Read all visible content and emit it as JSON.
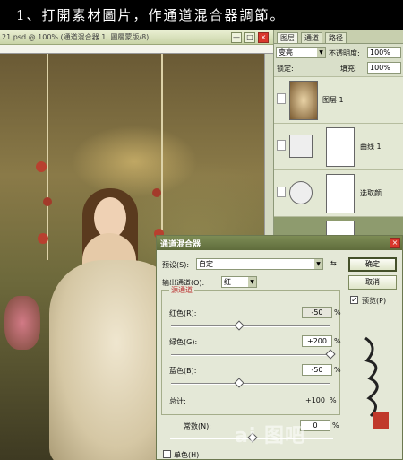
{
  "banner": {
    "text": "1、打開素材圖片，作通道混合器調節。"
  },
  "document": {
    "title": "21.psd @ 100% (通道混合器 1, 圖層蒙版/8)",
    "minimize": "—",
    "maximize": "□",
    "close": "×"
  },
  "layers_panel": {
    "tabs": [
      "图层",
      "通道",
      "路径"
    ],
    "blend_mode": "变亮",
    "opacity_label": "不透明度:",
    "opacity_value": "100%",
    "lock_label": "锁定:",
    "fill_label": "填充:",
    "fill_value": "100%",
    "layers": [
      {
        "name": "图层 1"
      },
      {
        "name": "曲线 1"
      },
      {
        "name": "选取颜..."
      },
      {
        "name": ""
      }
    ]
  },
  "dialog": {
    "title": "通道混合器",
    "preset_label": "预设(S):",
    "preset_value": "自定",
    "output_label": "输出通道(O):",
    "output_value": "红",
    "source_label": "源通道",
    "red_label": "红色(R):",
    "red_value": "-50",
    "green_label": "绿色(G):",
    "green_value": "+200",
    "blue_label": "蓝色(B):",
    "blue_value": "-50",
    "total_label": "总计:",
    "total_value": "+100",
    "constant_label": "常数(N):",
    "constant_value": "0",
    "percent": "%",
    "ok": "确定",
    "reset": "取消",
    "preview_label": "预览(P)",
    "preview_checked": "✓",
    "mono_label": "单色(H)"
  },
  "watermark": "ai 图吧"
}
